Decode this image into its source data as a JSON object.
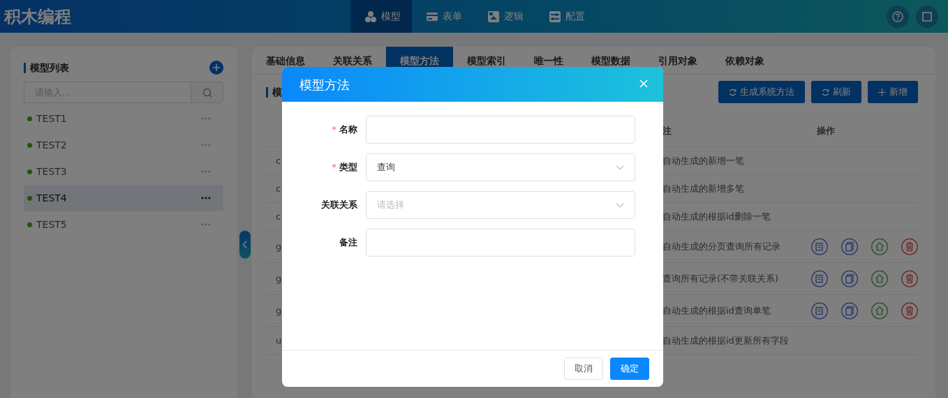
{
  "app": {
    "title": "积木编程"
  },
  "top_nav": [
    {
      "label": "模型",
      "kind": "cubes",
      "selected": true
    },
    {
      "label": "表单",
      "kind": "form",
      "selected": false
    },
    {
      "label": "逻辑",
      "kind": "logic",
      "selected": false
    },
    {
      "label": "配置",
      "kind": "config",
      "selected": false
    }
  ],
  "sidebar": {
    "title": "模型列表",
    "search": {
      "placeholder": "请输入..."
    },
    "items": [
      {
        "label": "TEST1",
        "selected": false
      },
      {
        "label": "TEST2",
        "selected": false
      },
      {
        "label": "TEST3",
        "selected": false
      },
      {
        "label": "TEST4",
        "selected": true
      },
      {
        "label": "TEST5",
        "selected": false
      }
    ]
  },
  "tabs": [
    {
      "label": "基础信息",
      "selected": false
    },
    {
      "label": "关联关系",
      "selected": false
    },
    {
      "label": "模型方法",
      "selected": true
    },
    {
      "label": "模型索引",
      "selected": false
    },
    {
      "label": "唯一性",
      "selected": false
    },
    {
      "label": "模型数据",
      "selected": false
    },
    {
      "label": "引用对象",
      "selected": false
    },
    {
      "label": "依赖对象",
      "selected": false
    }
  ],
  "section": {
    "title": "模"
  },
  "toolbar": [
    {
      "label": "生成系统方法",
      "kind": "refresh"
    },
    {
      "label": "刷新",
      "kind": "refresh"
    },
    {
      "label": "新增",
      "kind": "add"
    }
  ],
  "table": {
    "columns": [
      "",
      "注",
      "操作"
    ],
    "rows": [
      {
        "cells": [
          "c",
          "自动生成的新增一笔"
        ],
        "has_actions": false
      },
      {
        "cells": [
          "c",
          "自动生成的新增多笔"
        ],
        "has_actions": false
      },
      {
        "cells": [
          "c",
          "自动生成的根据id删除一笔"
        ],
        "has_actions": false
      },
      {
        "cells": [
          "g",
          "自动生成的分页查询所有记录"
        ],
        "has_actions": true
      },
      {
        "cells": [
          "g",
          "查询所有记录(不带关联关系)"
        ],
        "has_actions": true
      },
      {
        "cells": [
          "g",
          "自动生成的根据id查询单笔"
        ],
        "has_actions": true
      },
      {
        "cells": [
          "u",
          "自动生成的根据id更新所有字段"
        ],
        "has_actions": false
      }
    ]
  },
  "dialog": {
    "title": "模型方法",
    "fields": [
      {
        "label": "名称",
        "required_mark": "*",
        "kind": "input"
      },
      {
        "label": "类型",
        "required_mark": "*",
        "kind": "select",
        "value": "查询"
      },
      {
        "label": "关联关系",
        "kind": "select",
        "placeholder": "请选择"
      },
      {
        "label": "备注",
        "kind": "input"
      }
    ],
    "buttons": [
      {
        "label": "取消",
        "kind": "secondary"
      },
      {
        "label": "确定",
        "kind": "primary"
      }
    ]
  }
}
